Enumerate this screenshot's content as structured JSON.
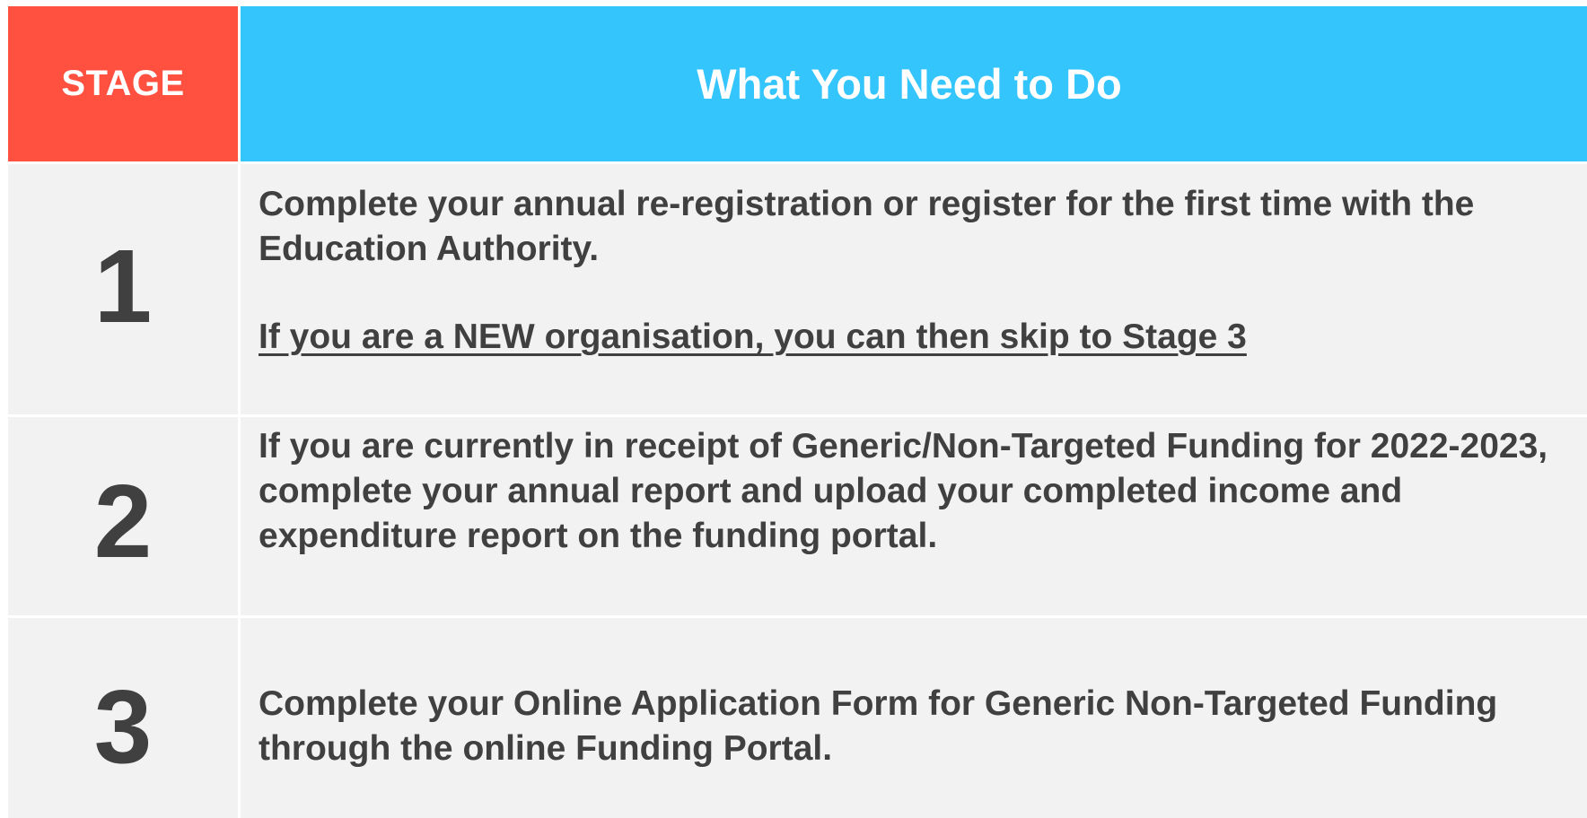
{
  "header": {
    "stage_label": "STAGE",
    "task_label": "What You Need to Do"
  },
  "rows": [
    {
      "stage": "1",
      "text": "Complete your annual re-registration or register for the first time with the Education Authority.",
      "note": "If you are a NEW organisation, you can then skip to Stage 3"
    },
    {
      "stage": "2",
      "text": "If you are currently in receipt of Generic/Non-Targeted Funding for 2022-2023, complete your annual report and upload your completed income and expenditure report on the funding portal."
    },
    {
      "stage": "3",
      "text": "Complete your Online Application Form for Generic Non-Targeted Funding through the online Funding Portal."
    }
  ],
  "colors": {
    "stage_header_bg": "#ff5040",
    "task_header_bg": "#33c5fc",
    "body_bg": "#f2f2f2",
    "text": "#404040"
  }
}
